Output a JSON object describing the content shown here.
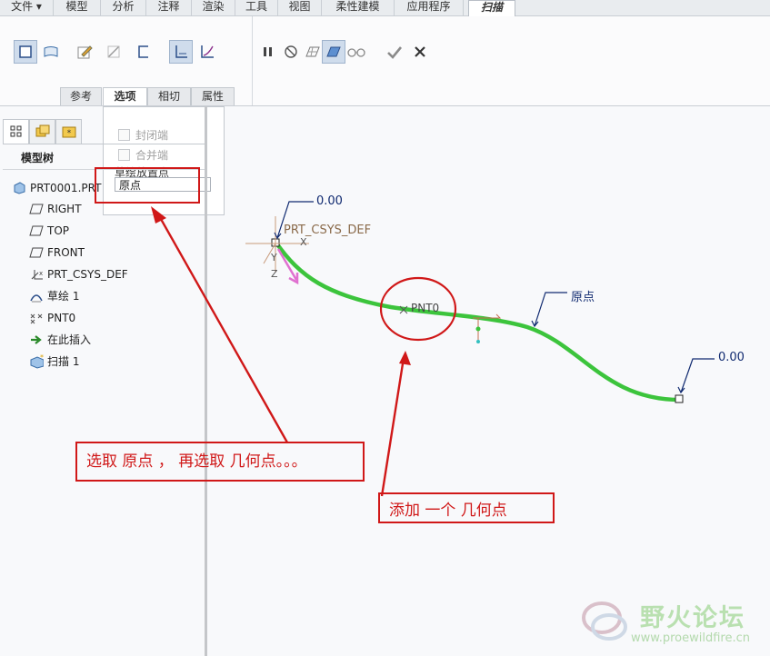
{
  "menubar": {
    "items": [
      {
        "label": "文件 ▾"
      },
      {
        "label": "模型"
      },
      {
        "label": "分析"
      },
      {
        "label": "注释"
      },
      {
        "label": "渲染"
      },
      {
        "label": "工具"
      },
      {
        "label": "视图"
      },
      {
        "label": "柔性建模"
      },
      {
        "label": "应用程序"
      },
      {
        "label": "扫描"
      }
    ]
  },
  "ribbon": {
    "subtabs": [
      {
        "label": "参考"
      },
      {
        "label": "选项"
      },
      {
        "label": "相切"
      },
      {
        "label": "属性"
      }
    ]
  },
  "options": {
    "closed_end": "封闭端",
    "merge_end": "合并端",
    "sketch_origin_label": "草绘放置点",
    "sketch_origin_value": "原点"
  },
  "model_tree": {
    "title": "模型树",
    "root": "PRT0001.PRT",
    "items": [
      {
        "label": "RIGHT"
      },
      {
        "label": "TOP"
      },
      {
        "label": "FRONT"
      },
      {
        "label": "PRT_CSYS_DEF"
      },
      {
        "label": "草绘 1"
      },
      {
        "label": "PNT0"
      },
      {
        "label": "在此插入"
      },
      {
        "label": "扫描 1"
      }
    ]
  },
  "viewport": {
    "dim_start": "0.00",
    "dim_end": "0.00",
    "csys_label": "PRT_CSYS_DEF",
    "axis_x": "X",
    "axis_y": "Y",
    "axis_z": "Z",
    "point_label": "PNT0",
    "origin_label": "原点",
    "curve_color": "#3cc43c"
  },
  "annotations": {
    "note_left": "选取  原点  ， 再选取  几何点。。。",
    "note_right": "添加  一个  几何点",
    "color": "#d01818"
  },
  "watermark": {
    "brand": "野火论坛",
    "url": "www.proewildfire.cn"
  }
}
